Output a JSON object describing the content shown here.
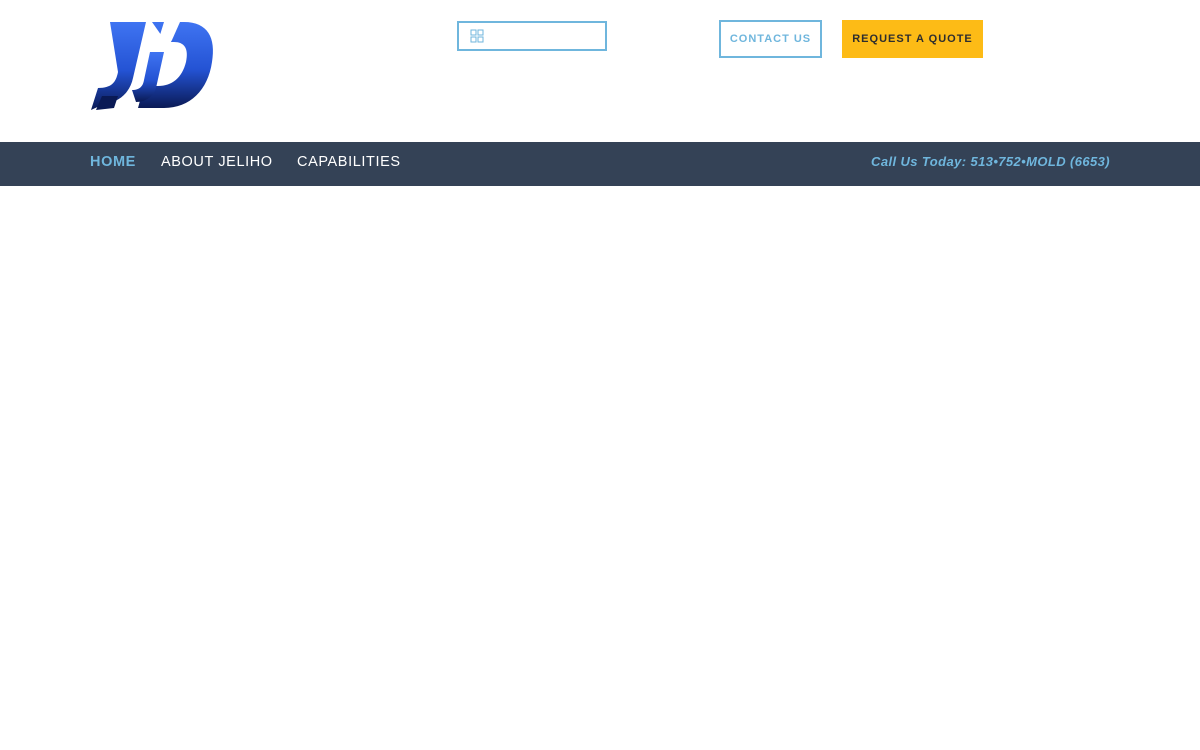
{
  "header": {
    "search": {
      "value": "",
      "placeholder": ""
    },
    "contact_label": "CONTACT US",
    "quote_label": "REQUEST A QUOTE"
  },
  "nav": {
    "items": [
      {
        "label": "HOME",
        "active": true
      },
      {
        "label": "ABOUT JELIHO",
        "active": false
      },
      {
        "label": "CAPABILITIES",
        "active": false
      }
    ],
    "phone": "Call Us Today: 513•752•MOLD (6653)"
  },
  "colors": {
    "accent": "#6fb6dd",
    "navbar": "#344256",
    "quote_button": "#fdbb16",
    "logo_top": "#3b6de8",
    "logo_bottom": "#0b1f5c"
  },
  "icons": {
    "search": "search-icon",
    "logo": "logo-icon"
  }
}
